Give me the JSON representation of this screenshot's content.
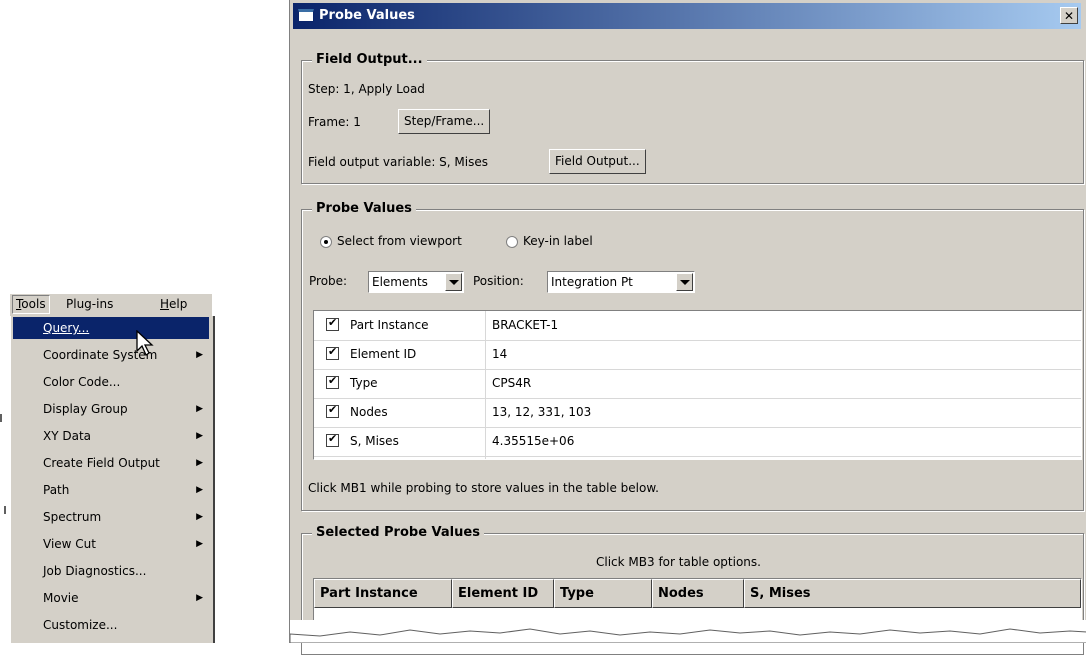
{
  "menu": {
    "bar": [
      "Tools",
      "Plug-ins",
      "Help"
    ],
    "items": [
      {
        "label": "Query...",
        "submenu": false
      },
      {
        "label": "Coordinate System",
        "submenu": true
      },
      {
        "label": "Color Code...",
        "submenu": false
      },
      {
        "label": "Display Group",
        "submenu": true
      },
      {
        "label": "XY Data",
        "submenu": true
      },
      {
        "label": "Create Field Output",
        "submenu": true
      },
      {
        "label": "Path",
        "submenu": true
      },
      {
        "label": "Spectrum",
        "submenu": true
      },
      {
        "label": "View Cut",
        "submenu": true
      },
      {
        "label": "Job Diagnostics...",
        "submenu": false
      },
      {
        "label": "Movie",
        "submenu": true
      },
      {
        "label": "Customize...",
        "submenu": false
      }
    ],
    "arrow": "▶"
  },
  "dialog": {
    "title": "Probe Values",
    "close": "✕",
    "field_output": {
      "group_title": "Field Output...",
      "step": "Step:  1, Apply Load",
      "frame_label": "Frame:  1",
      "frame_button": "Step/Frame...",
      "var_label": "Field output variable:  S, Mises",
      "var_button": "Field Output..."
    },
    "probe": {
      "group_title": "Probe Values",
      "radio1": "Select from viewport",
      "radio2": "Key-in label",
      "probe_label": "Probe:",
      "probe_value": "Elements",
      "position_label": "Position:",
      "position_value": "Integration Pt",
      "rows": [
        {
          "name": "Part Instance",
          "value": "BRACKET-1"
        },
        {
          "name": "Element ID",
          "value": "14"
        },
        {
          "name": "Type",
          "value": "CPS4R"
        },
        {
          "name": "Nodes",
          "value": "13, 12, 331, 103"
        },
        {
          "name": "S, Mises",
          "value": "4.35515e+06"
        }
      ],
      "hint": "Click MB1 while probing to store values in the table below."
    },
    "selected": {
      "group_title": "Selected Probe Values",
      "hint": "Click MB3 for table options.",
      "headers": [
        "Part Instance",
        "Element ID",
        "Type",
        "Nodes",
        "S, Mises"
      ]
    }
  }
}
